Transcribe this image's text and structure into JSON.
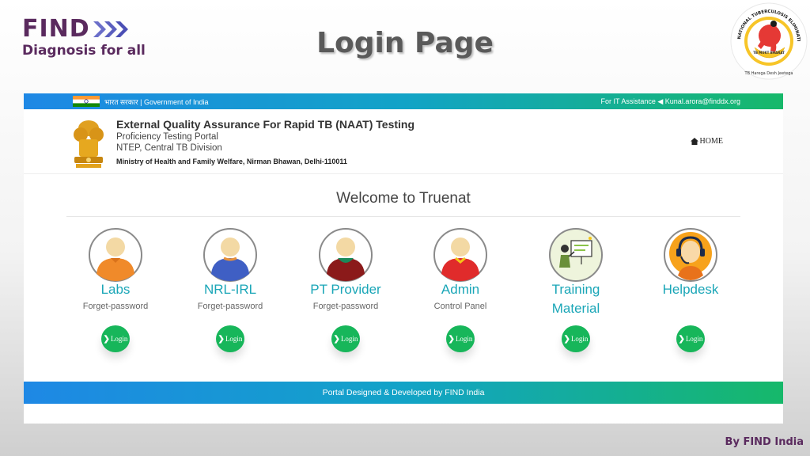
{
  "slide": {
    "title": "Login Page",
    "credit": "By FIND India",
    "find_logo": {
      "word": "FIND",
      "tagline": "Diagnosis for all"
    },
    "seal_text": "NATIONAL TUBERCULOSIS ELIMINATION PROGRAMME",
    "seal_slogan_1": "TB MUKT BHARAT",
    "seal_slogan_2": "TB Harega Desh Jeetega"
  },
  "portal": {
    "gov_bar": {
      "left_text": "भारत सरकार | Government of India",
      "right_text": "For IT Assistance ◀ Kunal.arora@finddx.org"
    },
    "header": {
      "title": "External Quality Assurance For Rapid TB (NAAT) Testing",
      "subtitle_1": "Proficiency Testing Portal",
      "subtitle_2": "NTEP, Central TB Division",
      "ministry": "Ministry of Health and Family Welfare, Nirman Bhawan, Delhi-110011",
      "home_label": "HOME"
    },
    "welcome": "Welcome to Truenat",
    "cards": [
      {
        "title": "Labs",
        "sub": "Forget-password",
        "button": "Login",
        "icon": "lab-user-avatar-icon"
      },
      {
        "title": "NRL-IRL",
        "sub": "Forget-password",
        "button": "Login",
        "icon": "nrl-user-avatar-icon"
      },
      {
        "title": "PT Provider",
        "sub": "Forget-password",
        "button": "Login",
        "icon": "pt-provider-avatar-icon"
      },
      {
        "title": "Admin",
        "sub": "Control Panel",
        "button": "Login",
        "icon": "admin-avatar-icon"
      },
      {
        "title": "Training Material",
        "sub": "",
        "button": "Login",
        "icon": "training-presenter-icon"
      },
      {
        "title": "Helpdesk",
        "sub": "",
        "button": "Login",
        "icon": "helpdesk-headset-icon"
      }
    ],
    "footer": "Portal Designed & Developed by FIND India"
  },
  "colors": {
    "brand_purple": "#5a2a5e",
    "accent_teal": "#1aa6b7",
    "login_green": "#17b65a",
    "bar_gradient_start": "#1e88e5",
    "bar_gradient_end": "#16b86a"
  }
}
